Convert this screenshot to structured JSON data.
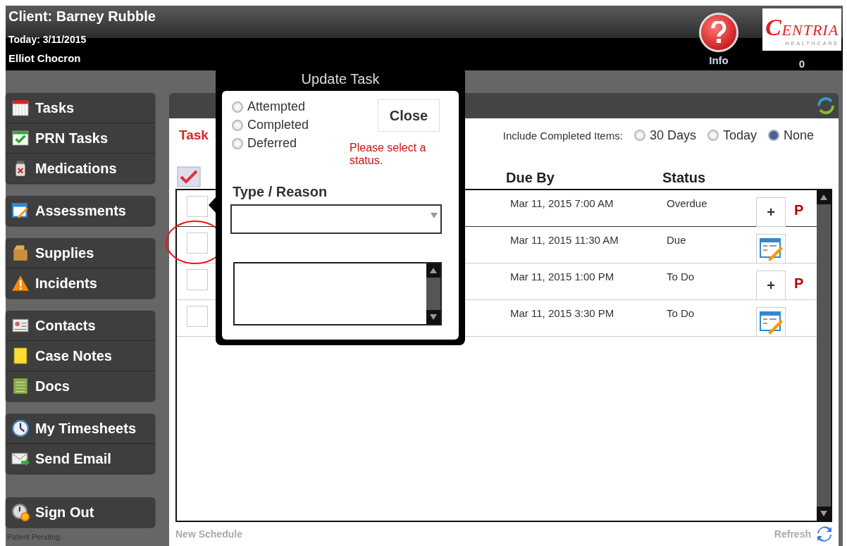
{
  "header": {
    "client": "Client: Barney Rubble",
    "today": "Today: 3/11/2015",
    "user": "Elliot Chocron",
    "info_label": "Info",
    "logo": {
      "name_initial": "C",
      "name_rest": "ENTRIA",
      "tagline": "HEALTHCARE"
    },
    "count": "0"
  },
  "sidebar": {
    "groups": [
      {
        "items": [
          "Tasks",
          "PRN Tasks",
          "Medications"
        ]
      },
      {
        "items": [
          "Assessments"
        ]
      },
      {
        "items": [
          "Supplies",
          "Incidents"
        ]
      },
      {
        "items": [
          "Contacts",
          "Case Notes",
          "Docs"
        ]
      },
      {
        "items": [
          "My Timesheets",
          "Send Email"
        ]
      },
      {
        "items": [
          "Sign Out"
        ]
      }
    ],
    "footnote": "Patent Pending."
  },
  "panel": {
    "title": "Task",
    "filter": {
      "label": "Include Completed Items:",
      "options": [
        {
          "label": "30 Days",
          "selected": false
        },
        {
          "label": "Today",
          "selected": false
        },
        {
          "label": "None",
          "selected": true
        }
      ]
    },
    "columns": [
      "Due By",
      "Status"
    ],
    "rows": [
      {
        "checked": false,
        "due": "Mar 11, 2015 7:00 AM",
        "status": "Overdue",
        "kind": "plus",
        "action_text": "+",
        "flag": "P"
      },
      {
        "checked": false,
        "due": "Mar 11, 2015 11:30 AM",
        "status": "Due",
        "kind": "form"
      },
      {
        "checked": false,
        "due": "Mar 11, 2015 1:00 PM",
        "status": "To Do",
        "kind": "plus",
        "action_text": "+",
        "flag": "P"
      },
      {
        "checked": false,
        "due": "Mar 11, 2015 3:30 PM",
        "status": "To Do",
        "kind": "form"
      }
    ],
    "footer_left": "New Schedule",
    "footer_right": "Refresh"
  },
  "dialog": {
    "title": "Update Task",
    "statuses": [
      {
        "label": "Attempted",
        "selected": false
      },
      {
        "label": "Completed",
        "selected": false
      },
      {
        "label": "Deferred",
        "selected": false
      }
    ],
    "close": "Close",
    "error": "Please select a status.",
    "type_label": "Type / Reason"
  }
}
